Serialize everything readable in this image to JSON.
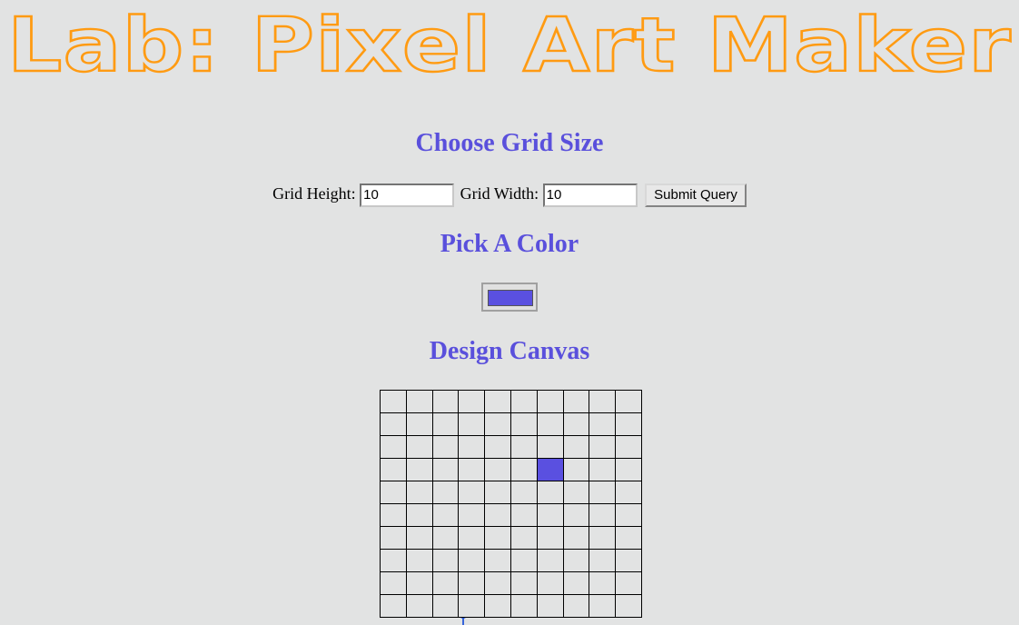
{
  "header": {
    "title": "Lab: Pixel Art Maker",
    "title_color": "#ff9b13"
  },
  "grid_size": {
    "heading": "Choose Grid Size",
    "height_label": "Grid Height:",
    "height_value": "10",
    "width_label": "Grid Width:",
    "width_value": "10",
    "submit_label": "Submit Query"
  },
  "color": {
    "heading": "Pick A Color",
    "selected": "#5a50e0"
  },
  "canvas": {
    "heading": "Design Canvas",
    "rows": 10,
    "cols": 10,
    "painted_cells": [
      {
        "row": 3,
        "col": 6,
        "color": "#5a50e0"
      }
    ]
  },
  "footer": {
    "link_text": "I"
  }
}
